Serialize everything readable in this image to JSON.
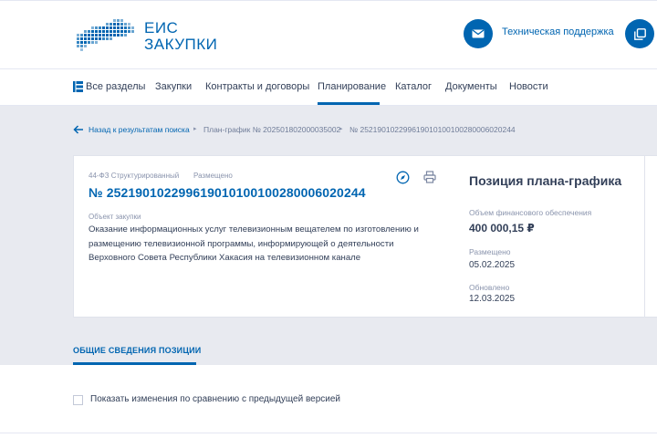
{
  "header": {
    "logo_line1": "ЕИС",
    "logo_line2": "ЗАКУПКИ",
    "support_label": "Техническая поддержка",
    "support_icon": "mail-icon",
    "right_icon": "window-icon"
  },
  "nav": {
    "items": [
      {
        "label": "Все разделы",
        "icon": "menu-grid-icon"
      },
      {
        "label": "Закупки"
      },
      {
        "label": "Контракты и договоры"
      },
      {
        "label": "Планирование",
        "active": true
      },
      {
        "label": "Каталог"
      },
      {
        "label": "Документы"
      },
      {
        "label": "Новости"
      }
    ]
  },
  "breadcrumb": {
    "back": "Назад к результатам поиска",
    "plan": "План-график № 202501802000035002",
    "position": "№ 252190102299619010100100280006020244"
  },
  "card": {
    "law": "44-ФЗ Структурированный",
    "status": "Размещено",
    "reg_number": "№ 252190102299619010100100280006020244",
    "object_label": "Объект закупки",
    "object_text": "Оказание информационных услуг телевизионным вещателем по изготовлению и размещению телевизионной программы, информирующей о деятельности Верховного Совета Республики Хакасия на телевизионном канале"
  },
  "side": {
    "title": "Позиция плана-графика",
    "finance_label": "Объем финансового обеспечения",
    "finance_value": "400 000,15 ₽",
    "placed_label": "Размещено",
    "placed_value": "05.02.2025",
    "updated_label": "Обновлено",
    "updated_value": "12.03.2025"
  },
  "tabs": {
    "general": "ОБЩИЕ СВЕДЕНИЯ ПОЗИЦИИ"
  },
  "compare": {
    "label": "Показать изменения по сравнению с предыдущей версией",
    "checked": false
  },
  "colors": {
    "brand": "#0065b1",
    "text": "#334059",
    "muted": "#8a94ad",
    "band": "#e8eaf0"
  }
}
